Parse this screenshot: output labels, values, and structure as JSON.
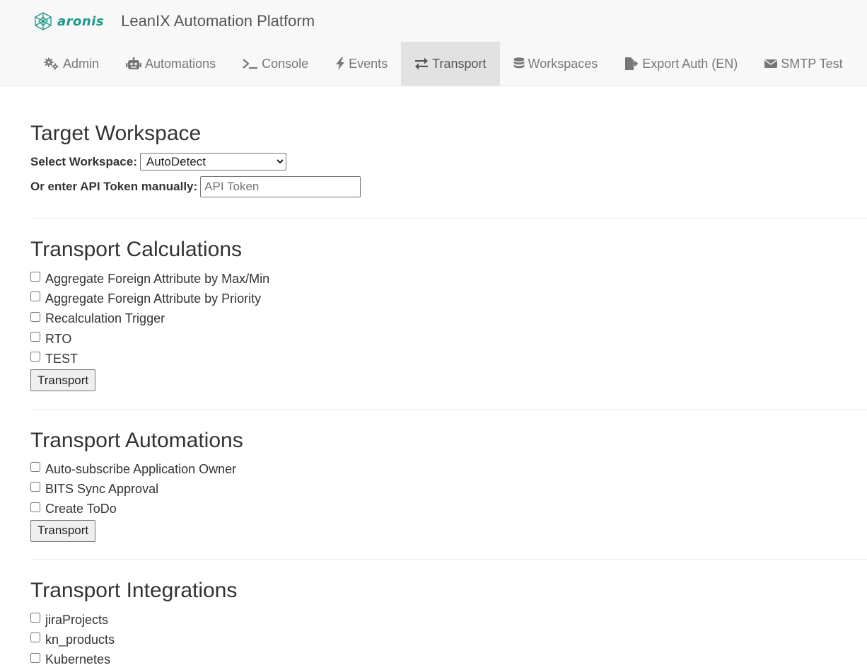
{
  "brand": {
    "logo_text": "aronis",
    "app_title": "LeanIX Automation Platform"
  },
  "nav": [
    {
      "label": "Admin",
      "icon": "gears-icon"
    },
    {
      "label": "Automations",
      "icon": "robot-icon"
    },
    {
      "label": "Console",
      "icon": "terminal-icon"
    },
    {
      "label": "Events",
      "icon": "bolt-icon"
    },
    {
      "label": "Transport",
      "icon": "exchange-icon",
      "active": true
    },
    {
      "label": "Workspaces",
      "icon": "database-icon"
    },
    {
      "label": "Export Auth (EN)",
      "icon": "file-export-icon"
    },
    {
      "label": "SMTP Test",
      "icon": "envelope-icon"
    }
  ],
  "target": {
    "title": "Target Workspace",
    "select_label": "Select Workspace:",
    "select_value": "AutoDetect",
    "token_label": "Or enter API Token manually:",
    "token_placeholder": "API Token"
  },
  "calculations": {
    "title": "Transport Calculations",
    "items": [
      "Aggregate Foreign Attribute by Max/Min",
      "Aggregate Foreign Attribute by Priority",
      "Recalculation Trigger",
      "RTO",
      "TEST"
    ],
    "button": "Transport"
  },
  "automations": {
    "title": "Transport Automations",
    "items": [
      "Auto-subscribe Application Owner",
      "BITS Sync Approval",
      "Create ToDo"
    ],
    "button": "Transport"
  },
  "integrations": {
    "title": "Transport Integrations",
    "items": [
      "jiraProjects",
      "kn_products",
      "Kubernetes"
    ]
  },
  "colors": {
    "brand_teal": "#1a9a8a",
    "nav_bg": "#f8f8f8",
    "nav_active_bg": "#e2e2e2"
  }
}
